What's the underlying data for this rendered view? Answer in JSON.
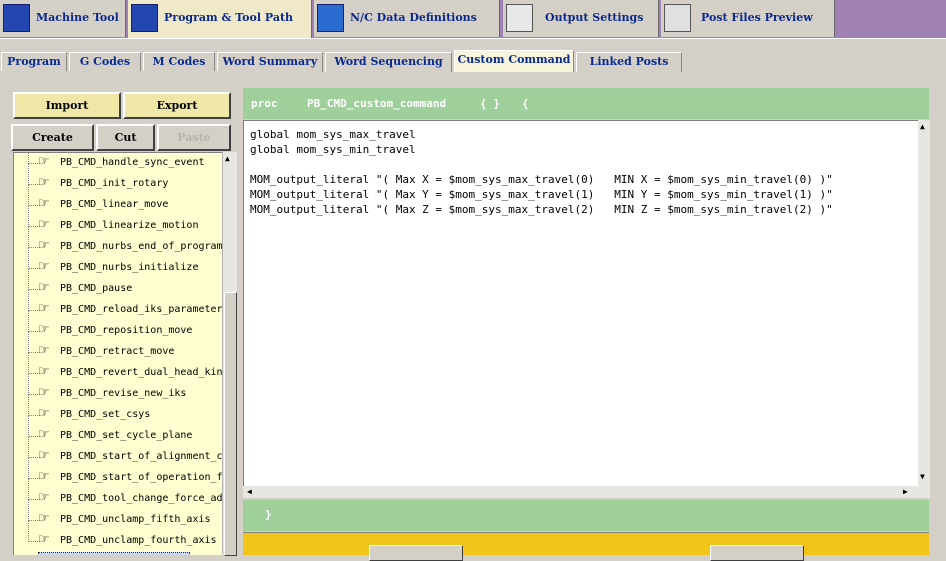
{
  "top_tabs": [
    {
      "label": "Machine Tool",
      "icon": "machine-tool-icon",
      "active": false
    },
    {
      "label": "Program & Tool Path",
      "icon": "program-toolpath-icon",
      "active": true
    },
    {
      "label": "N/C Data Definitions",
      "icon": "nc-data-icon",
      "active": false
    },
    {
      "label": "Output Settings",
      "icon": "output-settings-icon",
      "active": false
    },
    {
      "label": "Post Files Preview",
      "icon": "printer-icon",
      "active": false
    }
  ],
  "sub_tabs": [
    {
      "label": "Program"
    },
    {
      "label": "G Codes"
    },
    {
      "label": "M Codes"
    },
    {
      "label": "Word Summary"
    },
    {
      "label": "Word Sequencing"
    },
    {
      "label": "Custom Command"
    },
    {
      "label": "Linked Posts"
    }
  ],
  "buttons": {
    "import": "Import",
    "export": "Export",
    "create": "Create",
    "cut": "Cut",
    "paste": "Paste"
  },
  "tree_items": [
    "PB_CMD_handle_sync_event",
    "PB_CMD_init_rotary",
    "PB_CMD_linear_move",
    "PB_CMD_linearize_motion",
    "PB_CMD_nurbs_end_of_program",
    "PB_CMD_nurbs_initialize",
    "PB_CMD_pause",
    "PB_CMD_reload_iks_parameters",
    "PB_CMD_reposition_move",
    "PB_CMD_retract_move",
    "PB_CMD_revert_dual_head_kin",
    "PB_CMD_revise_new_iks",
    "PB_CMD_set_csys",
    "PB_CMD_set_cycle_plane",
    "PB_CMD_start_of_alignment_c",
    "PB_CMD_start_of_operation_f",
    "PB_CMD_tool_change_force_ad",
    "PB_CMD_unclamp_fifth_axis",
    "PB_CMD_unclamp_fourth_axis"
  ],
  "proc_header": {
    "keyword": "proc",
    "name": "PB_CMD_custom_command",
    "args": "{ }",
    "open_brace": "{"
  },
  "code_lines": [
    "global mom_sys_max_travel",
    "global mom_sys_min_travel",
    "",
    "MOM_output_literal \"( Max X = $mom_sys_max_travel(0)   MIN X = $mom_sys_min_travel(0) )\"",
    "MOM_output_literal \"( Max Y = $mom_sys_max_travel(1)   MIN Y = $mom_sys_min_travel(1) )\"",
    "MOM_output_literal \"( Max Z = $mom_sys_max_travel(2)   MIN Z = $mom_sys_min_travel(2) )\""
  ],
  "close_brace": "}",
  "colors": {
    "accent_green": "#9fcf9b",
    "tree_background": "#fefed0",
    "tab_text": "#0b2a8e",
    "bottom_bar": "#f0c419",
    "tab_strip": "#a081b3"
  }
}
